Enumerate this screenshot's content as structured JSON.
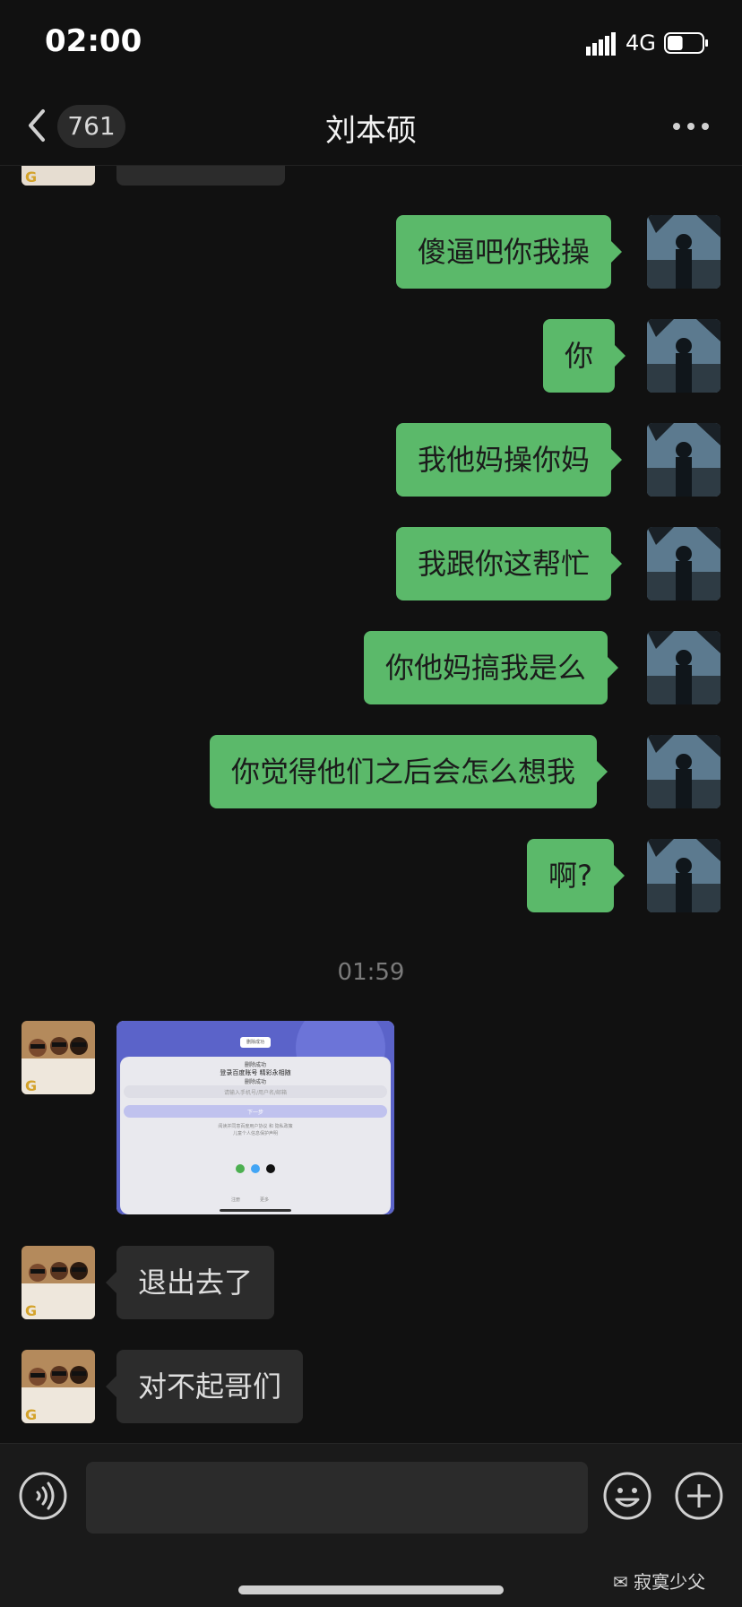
{
  "status_bar": {
    "time": "02:00",
    "network": "4G",
    "battery_percent": 45
  },
  "nav": {
    "unread_count": "761",
    "title": "刘本硕"
  },
  "messages": [
    {
      "side": "me",
      "text": "傻逼吧你我操"
    },
    {
      "side": "me",
      "text": "你"
    },
    {
      "side": "me",
      "text": "我他妈操你妈"
    },
    {
      "side": "me",
      "text": "我跟你这帮忙"
    },
    {
      "side": "me",
      "text": "你他妈搞我是么"
    },
    {
      "side": "me",
      "text": "你觉得他们之后会怎么想我"
    },
    {
      "side": "me",
      "text": "啊?"
    }
  ],
  "timestamp": "01:59",
  "incoming": [
    {
      "side": "them",
      "type": "image"
    },
    {
      "side": "them",
      "text": "退出去了"
    },
    {
      "side": "them",
      "text": "对不起哥们"
    }
  ],
  "screenshot_content": {
    "top_chip": "删除成功",
    "chip2": "删除成功",
    "heading": "登录百度账号 精彩永相随",
    "chip3": "删除成功",
    "field_placeholder": "请输入手机号/用户名/邮箱",
    "button": "下一步",
    "agree": "阅读并同意百度用户协议 和 隐私政策",
    "agree2": "儿童个人信息保护声明",
    "footer_left": "注册",
    "footer_right": "更多"
  },
  "watermark": "寂寞少父",
  "colors": {
    "my_bubble": "#5bb96a",
    "their_bubble": "#2c2c2c",
    "background": "#111111"
  }
}
